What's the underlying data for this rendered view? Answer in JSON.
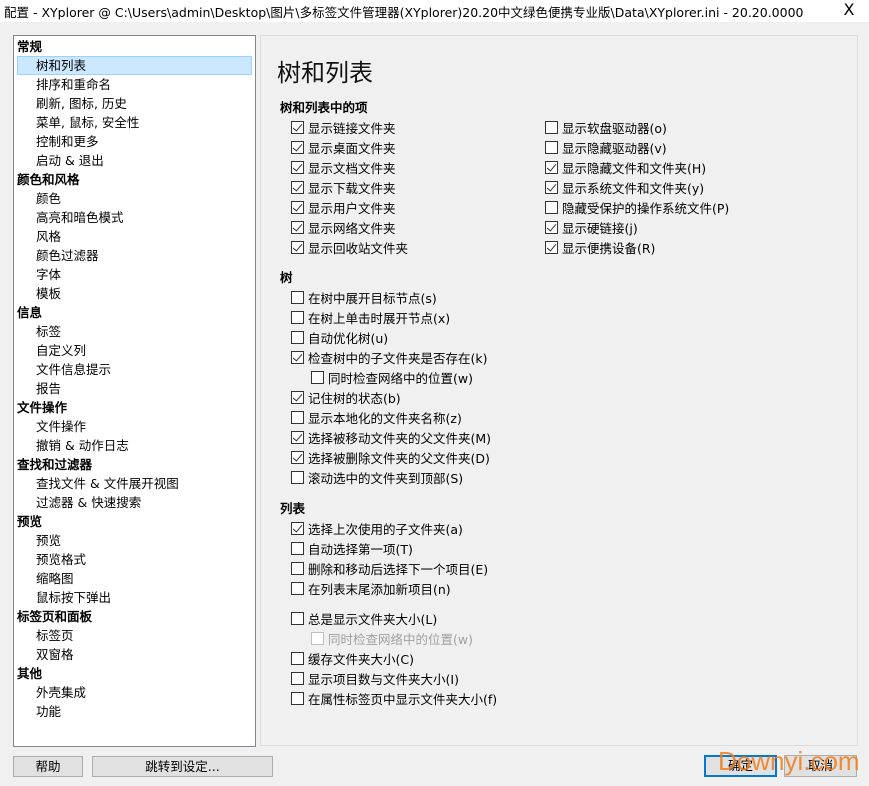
{
  "window": {
    "title": "配置 - XYplorer @ C:\\Users\\admin\\Desktop\\图片\\多标签文件管理器(XYplorer)20.20中文绿色便携专业版\\Data\\XYplorer.ini - 20.20.0000",
    "close": "X"
  },
  "sidebar": {
    "items": [
      {
        "label": "常规",
        "group": true
      },
      {
        "label": "树和列表",
        "selected": true
      },
      {
        "label": "排序和重命名"
      },
      {
        "label": "刷新, 图标, 历史"
      },
      {
        "label": "菜单, 鼠标, 安全性"
      },
      {
        "label": "控制和更多"
      },
      {
        "label": "启动 & 退出"
      },
      {
        "label": "颜色和风格",
        "group": true
      },
      {
        "label": "颜色"
      },
      {
        "label": "高亮和暗色模式"
      },
      {
        "label": "风格"
      },
      {
        "label": "颜色过滤器"
      },
      {
        "label": "字体"
      },
      {
        "label": "模板"
      },
      {
        "label": "信息",
        "group": true
      },
      {
        "label": "标签"
      },
      {
        "label": "自定义列"
      },
      {
        "label": "文件信息提示"
      },
      {
        "label": "报告"
      },
      {
        "label": "文件操作",
        "group": true
      },
      {
        "label": "文件操作"
      },
      {
        "label": "撤销 & 动作日志"
      },
      {
        "label": "查找和过滤器",
        "group": true
      },
      {
        "label": "查找文件 & 文件展开视图"
      },
      {
        "label": "过滤器 & 快速搜索"
      },
      {
        "label": "预览",
        "group": true
      },
      {
        "label": "预览"
      },
      {
        "label": "预览格式"
      },
      {
        "label": "缩略图"
      },
      {
        "label": "鼠标按下弹出"
      },
      {
        "label": "标签页和面板",
        "group": true
      },
      {
        "label": "标签页"
      },
      {
        "label": "双窗格"
      },
      {
        "label": "其他",
        "group": true
      },
      {
        "label": "外壳集成"
      },
      {
        "label": "功能"
      }
    ]
  },
  "panel": {
    "title": "树和列表",
    "sections": [
      {
        "heading": "树和列表中的项",
        "columns": [
          [
            {
              "label": "显示链接文件夹",
              "checked": true
            },
            {
              "label": "显示桌面文件夹",
              "checked": true
            },
            {
              "label": "显示文档文件夹",
              "checked": true
            },
            {
              "label": "显示下载文件夹",
              "checked": true
            },
            {
              "label": "显示用户文件夹",
              "checked": true
            },
            {
              "label": "显示网络文件夹",
              "checked": true
            },
            {
              "label": "显示回收站文件夹",
              "checked": true
            }
          ],
          [
            {
              "label": "显示软盘驱动器(o)",
              "checked": false
            },
            {
              "label": "显示隐藏驱动器(v)",
              "checked": false
            },
            {
              "label": "显示隐藏文件和文件夹(H)",
              "checked": true
            },
            {
              "label": "显示系统文件和文件夹(y)",
              "checked": true
            },
            {
              "label": "隐藏受保护的操作系统文件(P)",
              "checked": false
            },
            {
              "label": "显示硬链接(j)",
              "checked": true
            },
            {
              "label": "显示便携设备(R)",
              "checked": true
            }
          ]
        ]
      },
      {
        "heading": "树",
        "columns": [
          [
            {
              "label": "在树中展开目标节点(s)",
              "checked": false
            },
            {
              "label": "在树上单击时展开节点(x)",
              "checked": false
            },
            {
              "label": "自动优化树(u)",
              "checked": false
            },
            {
              "label": "检查树中的子文件夹是否存在(k)",
              "checked": true
            },
            {
              "label": "同时检查网络中的位置(w)",
              "checked": false,
              "indent": true
            },
            {
              "label": "记住树的状态(b)",
              "checked": true
            },
            {
              "label": "显示本地化的文件夹名称(z)",
              "checked": false
            },
            {
              "label": "选择被移动文件夹的父文件夹(M)",
              "checked": true
            },
            {
              "label": "选择被删除文件夹的父文件夹(D)",
              "checked": true
            },
            {
              "label": "滚动选中的文件夹到顶部(S)",
              "checked": false
            }
          ]
        ]
      },
      {
        "heading": "列表",
        "columns": [
          [
            {
              "label": "选择上次使用的子文件夹(a)",
              "checked": true
            },
            {
              "label": "自动选择第一项(T)",
              "checked": false
            },
            {
              "label": "删除和移动后选择下一个项目(E)",
              "checked": false
            },
            {
              "label": "在列表末尾添加新项目(n)",
              "checked": false
            },
            {
              "label": "总是显示文件夹大小(L)",
              "checked": false
            },
            {
              "label": "同时检查网络中的位置(w)",
              "checked": false,
              "indent": true,
              "disabled": true
            },
            {
              "label": "缓存文件夹大小(C)",
              "checked": false
            },
            {
              "label": "显示项目数与文件夹大小(I)",
              "checked": false
            },
            {
              "label": "在属性标签页中显示文件夹大小(f)",
              "checked": false
            }
          ]
        ]
      }
    ]
  },
  "buttons": {
    "help": "帮助",
    "goto": "跳转到设定...",
    "ok": "确定",
    "cancel": "取消"
  },
  "watermark": "Downyi.com"
}
